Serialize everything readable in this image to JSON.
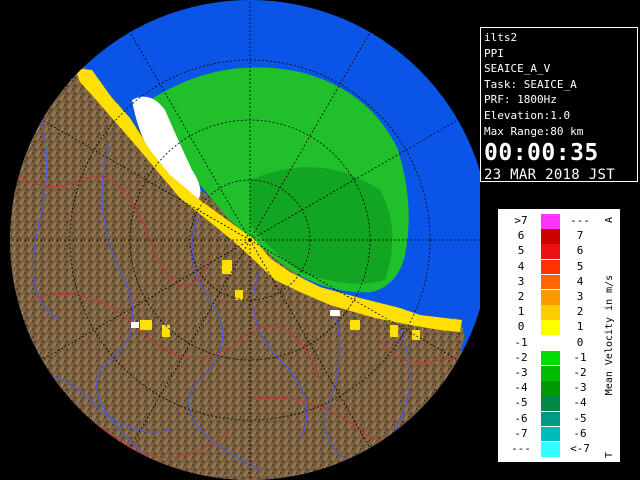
{
  "info": {
    "lines": [
      "ilts2",
      "PPI",
      "SEAICE_A_V",
      "Task: SEAICE_A",
      "PRF: 1800Hz",
      "Elevation:1.0",
      "Max Range:80 km"
    ],
    "time": "00:00:35",
    "date": "23 MAR 2018 JST"
  },
  "legend": {
    "title": "Mean Velocity in m/s",
    "end_top": "A",
    "end_bottom": "T",
    "rows": [
      {
        "left": ">7",
        "right": "---",
        "color": "#ff33ff"
      },
      {
        "left": "6",
        "right": "7",
        "color": "#cc0000"
      },
      {
        "left": "5",
        "right": "6",
        "color": "#ee1111"
      },
      {
        "left": "4",
        "right": "5",
        "color": "#ff3300"
      },
      {
        "left": "3",
        "right": "4",
        "color": "#ff6600"
      },
      {
        "left": "2",
        "right": "3",
        "color": "#ff9900"
      },
      {
        "left": "1",
        "right": "2",
        "color": "#ffcc00"
      },
      {
        "left": "0",
        "right": "1",
        "color": "#ffff00"
      },
      {
        "left": "-1",
        "right": "0",
        "color": "#ffffff"
      },
      {
        "left": "-2",
        "right": "-1",
        "color": "#00dd00"
      },
      {
        "left": "-3",
        "right": "-2",
        "color": "#00bb00"
      },
      {
        "left": "-4",
        "right": "-3",
        "color": "#009900"
      },
      {
        "left": "-5",
        "right": "-4",
        "color": "#008844"
      },
      {
        "left": "-6",
        "right": "-5",
        "color": "#009988"
      },
      {
        "left": "-7",
        "right": "-6",
        "color": "#00bbbb"
      },
      {
        "left": "---",
        "right": "<-7",
        "color": "#33ffff"
      }
    ]
  },
  "colors": {
    "sea": "#0a55e6",
    "out_of_range": "#000000",
    "terrain": "#7a6040",
    "rivers": "#4c5ad8",
    "boundaries": "#c23838",
    "range_rings": "#000000"
  }
}
